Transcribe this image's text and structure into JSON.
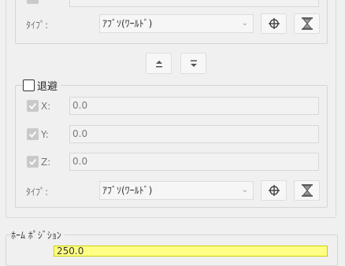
{
  "upper_group": {
    "type_label": "ﾀｲﾌﾟ:",
    "type_value": "ｱﾌﾞｿ(ﾜｰﾙﾄﾞ)"
  },
  "retreat": {
    "title": "退避",
    "checked": false,
    "axes": [
      {
        "label": "X:",
        "value": "0.0",
        "checked": true
      },
      {
        "label": "Y:",
        "value": "0.0",
        "checked": true
      },
      {
        "label": "Z:",
        "value": "0.0",
        "checked": true
      }
    ],
    "type_label": "ﾀｲﾌﾟ:",
    "type_value": "ｱﾌﾞｿ(ﾜｰﾙﾄﾞ)"
  },
  "home_position": {
    "title": "ﾎｰﾑ ﾎﾟｼﾞｼｮﾝ",
    "value": "250.0"
  },
  "icons": {
    "move_up": "move-up-icon",
    "move_down": "move-down-icon",
    "pick_target": "crosshair-icon",
    "hourglass": "hourglass-icon",
    "check": "check-icon"
  }
}
